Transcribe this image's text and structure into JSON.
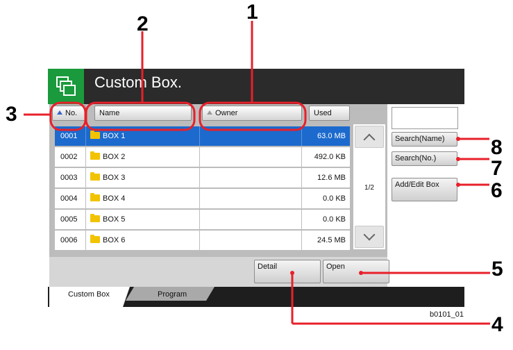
{
  "window": {
    "title": "Custom Box."
  },
  "columns": {
    "no": "No.",
    "name": "Name",
    "owner": "Owner",
    "used": "Used"
  },
  "rows": [
    {
      "no": "0001",
      "name": "BOX 1",
      "owner": "",
      "used": "63.0  MB",
      "selected": true
    },
    {
      "no": "0002",
      "name": "BOX 2",
      "owner": "",
      "used": "492.0  KB",
      "selected": false
    },
    {
      "no": "0003",
      "name": "BOX 3",
      "owner": "",
      "used": "12.6  MB",
      "selected": false
    },
    {
      "no": "0004",
      "name": "BOX 4",
      "owner": "",
      "used": "0.0  KB",
      "selected": false
    },
    {
      "no": "0005",
      "name": "BOX 5",
      "owner": "",
      "used": "0.0  KB",
      "selected": false
    },
    {
      "no": "0006",
      "name": "BOX 6",
      "owner": "",
      "used": "24.5  MB",
      "selected": false
    }
  ],
  "pagination": {
    "page": "1/2"
  },
  "buttons": {
    "search_name": "Search(Name)",
    "search_no": "Search(No.)",
    "add_edit": "Add/Edit Box",
    "detail": "Detail",
    "open": "Open"
  },
  "tabs": [
    {
      "label": "Custom Box",
      "active": true
    },
    {
      "label": "Program",
      "active": false
    }
  ],
  "callouts": {
    "c1": "1",
    "c2": "2",
    "c3": "3",
    "c4": "4",
    "c5": "5",
    "c6": "6",
    "c7": "7",
    "c8": "8"
  },
  "figure_id": "b0101_01",
  "colors": {
    "accent_red": "#e8202a",
    "selection_blue": "#1c6acd",
    "title_bar": "#2b2b2b",
    "icon_green": "#1a9a3c"
  }
}
